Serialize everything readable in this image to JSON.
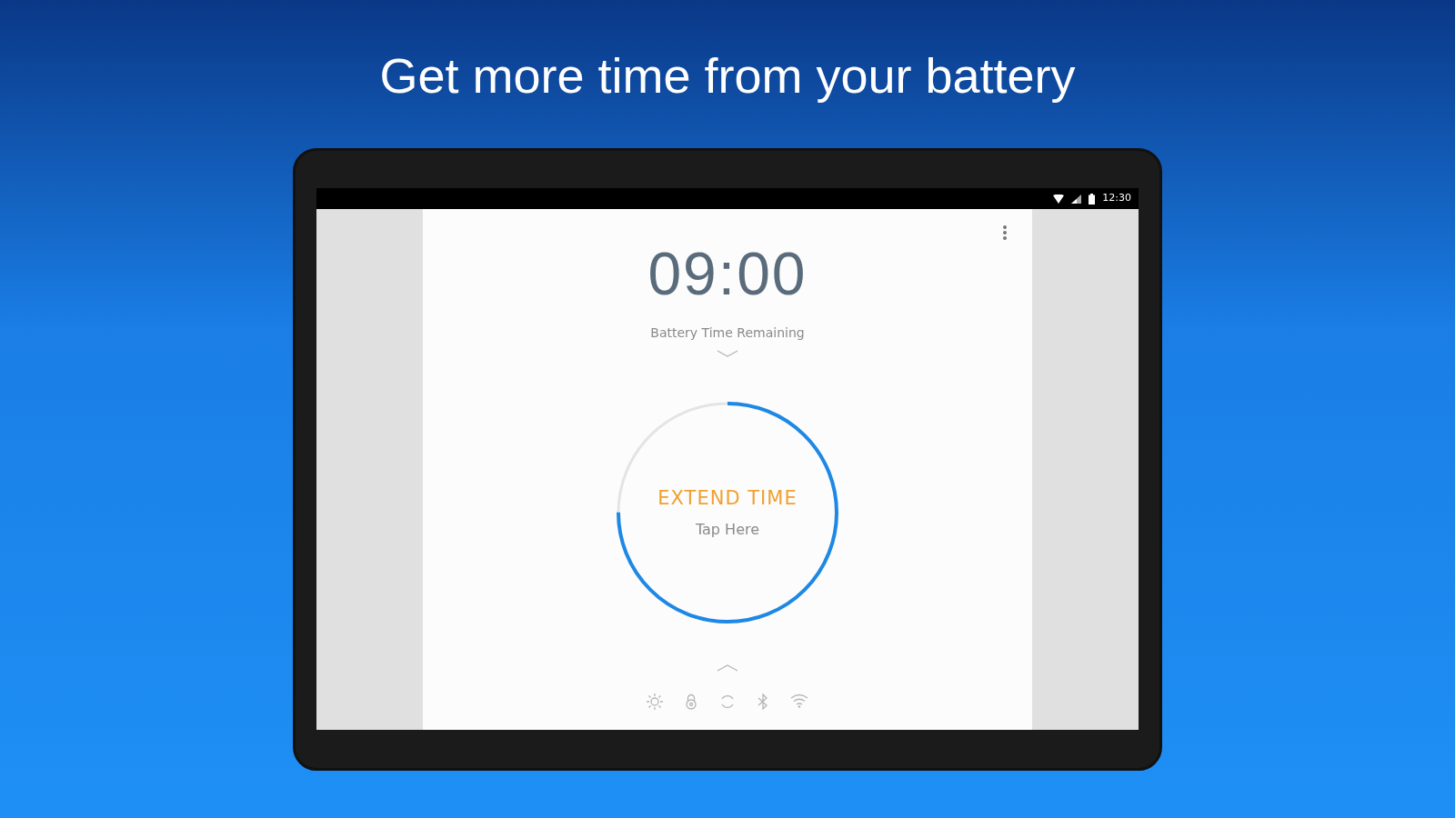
{
  "headline": "Get more time from your battery",
  "status_bar": {
    "time": "12:30"
  },
  "timer": {
    "time": "09:00",
    "label": "Battery Time Remaining"
  },
  "extend": {
    "title": "EXTEND TIME",
    "subtitle": "Tap Here"
  }
}
